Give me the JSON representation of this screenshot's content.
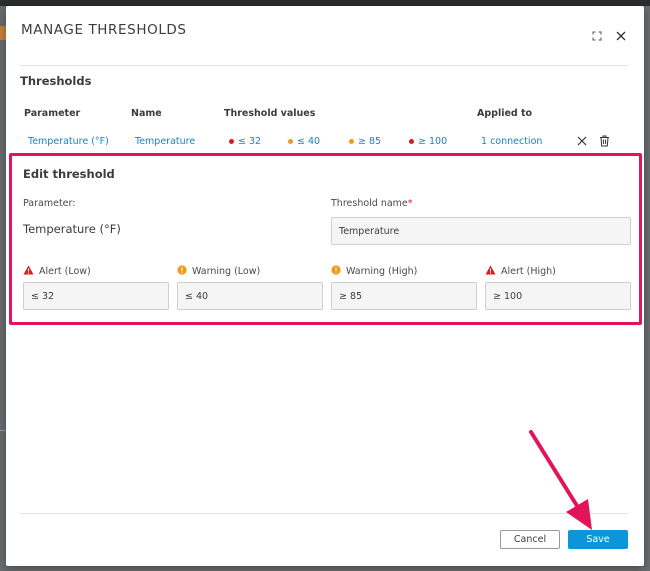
{
  "modal": {
    "title": "MANAGE THRESHOLDS"
  },
  "thresholds": {
    "section_title": "Thresholds",
    "columns": [
      "Parameter",
      "Name",
      "Threshold values",
      "Applied to"
    ],
    "row": {
      "parameter": "Temperature (°F)",
      "name": "Temperature",
      "values": [
        {
          "text": "≤ 32",
          "level": "alert"
        },
        {
          "text": "≤ 40",
          "level": "warning"
        },
        {
          "text": "≥ 85",
          "level": "warning"
        },
        {
          "text": "≥ 100",
          "level": "alert"
        }
      ],
      "applied_to": "1 connection"
    }
  },
  "edit": {
    "title": "Edit threshold",
    "parameter_label": "Parameter:",
    "parameter_value": "Temperature (°F)",
    "name_label": "Threshold name",
    "name_required_mark": "*",
    "name_value": "Temperature",
    "fields": [
      {
        "label": "Alert (Low)",
        "value": "≤ 32",
        "icon": "alert-triangle-icon"
      },
      {
        "label": "Warning (Low)",
        "value": "≤ 40",
        "icon": "warning-circle-icon"
      },
      {
        "label": "Warning (High)",
        "value": "≥ 85",
        "icon": "warning-circle-icon"
      },
      {
        "label": "Alert (High)",
        "value": "≥ 100",
        "icon": "alert-triangle-icon"
      }
    ]
  },
  "footer": {
    "cancel_label": "Cancel",
    "save_label": "Save"
  },
  "colors": {
    "primary": "#0a96d8",
    "link": "#1a83c2",
    "alert": "#d31e1e",
    "warning": "#f09a1a",
    "highlight": "#e2145a"
  }
}
